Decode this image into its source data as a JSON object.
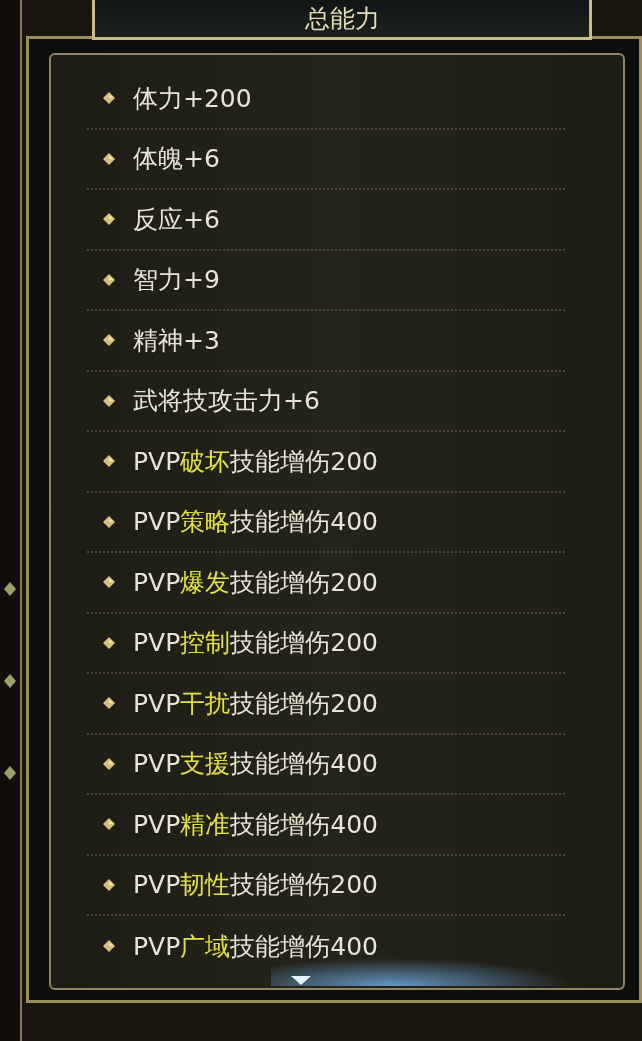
{
  "title": "总能力",
  "stats": [
    {
      "kind": "plain",
      "text": "体力+200"
    },
    {
      "kind": "plain",
      "text": "体魄+6"
    },
    {
      "kind": "plain",
      "text": "反应+6"
    },
    {
      "kind": "plain",
      "text": "智力+9"
    },
    {
      "kind": "plain",
      "text": "精神+3"
    },
    {
      "kind": "plain",
      "text": "武将技攻击力+6"
    },
    {
      "kind": "highlight",
      "before": "PVP",
      "highlight": "破坏",
      "after": "技能增伤200"
    },
    {
      "kind": "highlight",
      "before": "PVP",
      "highlight": "策略",
      "after": "技能增伤400"
    },
    {
      "kind": "highlight",
      "before": "PVP",
      "highlight": "爆发",
      "after": "技能增伤200"
    },
    {
      "kind": "highlight",
      "before": "PVP",
      "highlight": "控制",
      "after": "技能增伤200"
    },
    {
      "kind": "highlight",
      "before": "PVP",
      "highlight": "干扰",
      "after": "技能增伤200"
    },
    {
      "kind": "highlight",
      "before": "PVP",
      "highlight": "支援",
      "after": "技能增伤400"
    },
    {
      "kind": "highlight",
      "before": "PVP",
      "highlight": "精准",
      "after": "技能增伤400"
    },
    {
      "kind": "highlight",
      "before": "PVP",
      "highlight": "韧性",
      "after": "技能增伤200"
    },
    {
      "kind": "highlight",
      "before": "PVP",
      "highlight": "广域",
      "after": "技能增伤400"
    }
  ]
}
